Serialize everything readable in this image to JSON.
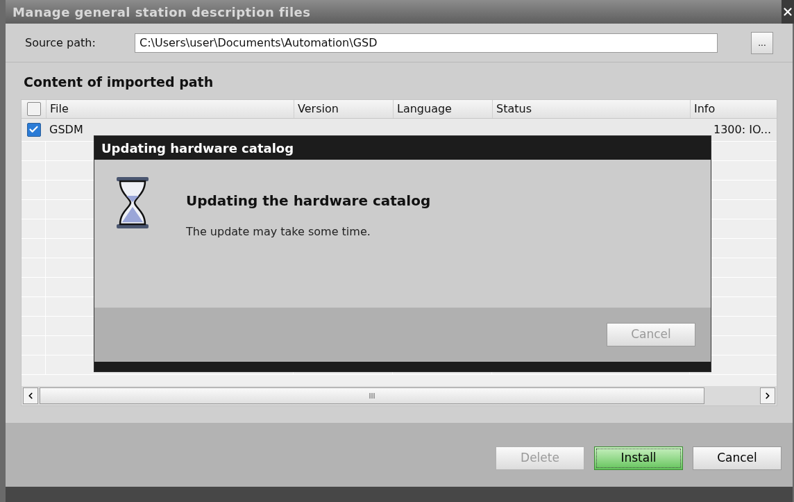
{
  "window": {
    "title": "Manage general station description files"
  },
  "source_path": {
    "label": "Source path:",
    "value": "C:\\Users\\user\\Documents\\Automation\\GSD",
    "browse_button": "..."
  },
  "section_title": "Content of imported path",
  "table": {
    "select_all_checked": false,
    "columns": [
      "File",
      "Version",
      "Language",
      "Status",
      "Info"
    ],
    "rows": [
      {
        "checked": true,
        "file": "GSDM",
        "info": "1300: IO..."
      }
    ]
  },
  "buttons": [
    {
      "label": "Delete",
      "kind": "default",
      "disabled": true
    },
    {
      "label": "Install",
      "kind": "primary",
      "disabled": false
    },
    {
      "label": "Cancel",
      "kind": "default",
      "disabled": false
    }
  ],
  "progress_dialog": {
    "title": "Updating hardware catalog",
    "heading": "Updating the hardware catalog",
    "message": "The update may take some time.",
    "cancel": {
      "label": "Cancel",
      "disabled": true
    }
  }
}
